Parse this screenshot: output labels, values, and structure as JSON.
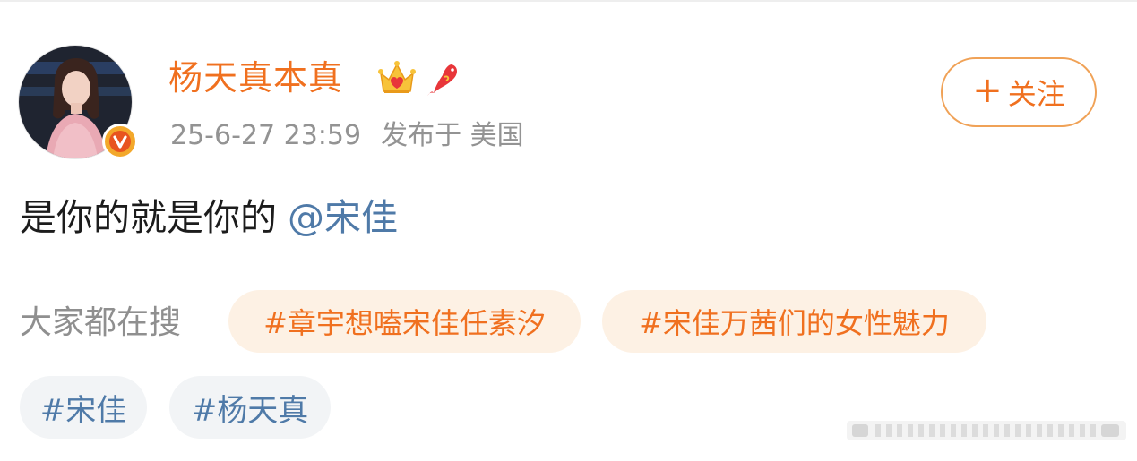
{
  "post": {
    "username": "杨天真本真",
    "timestamp": "25-6-27 23:59",
    "source": "发布于 美国",
    "follow_button": {
      "plus": "+",
      "label": "关注"
    },
    "content": {
      "text": "是你的就是你的",
      "mention": "@宋佳"
    },
    "search_section": {
      "label": "大家都在搜",
      "hot_topics": [
        "#章宇想嗑宋佳任素汐",
        "#宋佳万茜们的女性魅力"
      ]
    },
    "tags": [
      "#宋佳",
      "#杨天真"
    ],
    "badges": {
      "verified": "v"
    }
  },
  "colors": {
    "accent_orange": "#f0701f",
    "link_blue": "#4f7aa8",
    "meta_gray": "#939393",
    "hot_pill_bg": "#fdf1e4",
    "tag_pill_bg": "#f2f4f6",
    "verify_badge": "#f3a82b"
  },
  "icons": [
    "avatar-image",
    "verified-badge-icon",
    "crown-icon",
    "koi-fish-icon",
    "plus-icon",
    "watermark-icon"
  ]
}
